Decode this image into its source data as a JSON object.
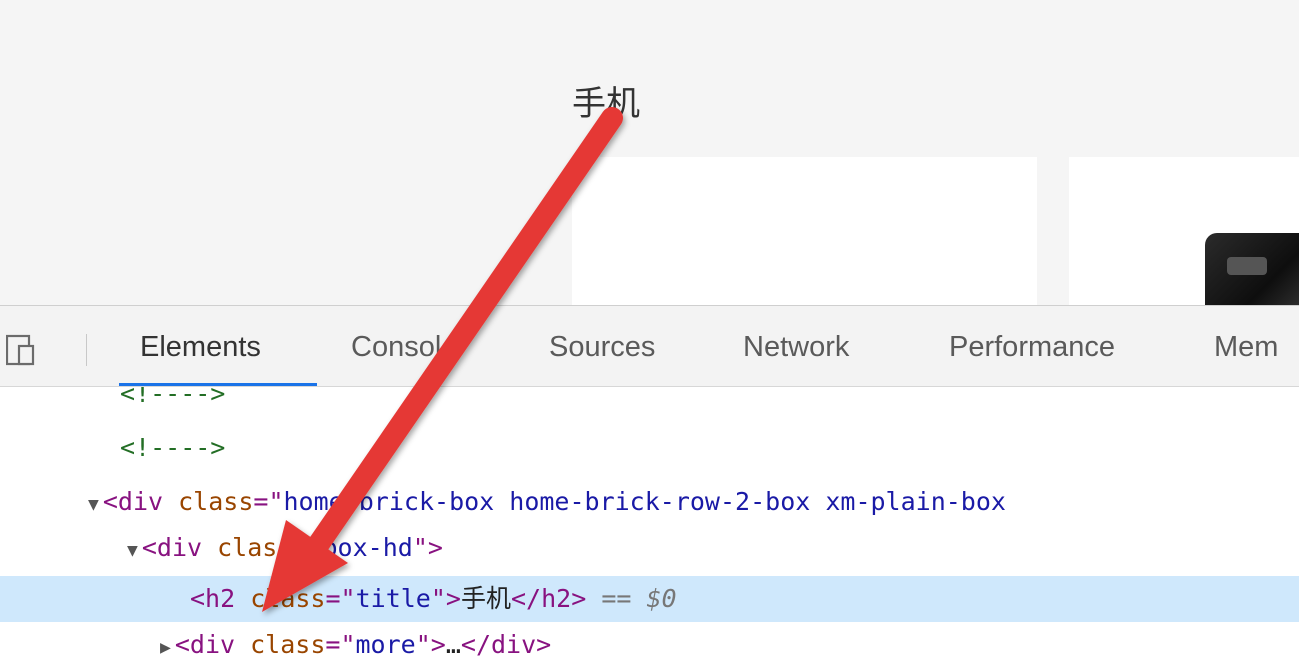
{
  "page": {
    "heading": "手机"
  },
  "devtools": {
    "tabs": [
      {
        "label": "Elements"
      },
      {
        "label": "Console"
      },
      {
        "label": "Sources"
      },
      {
        "label": "Network"
      },
      {
        "label": "Performance"
      },
      {
        "label": "Mem"
      }
    ],
    "active_tab": "Elements",
    "dom": {
      "comment1": "<!---->",
      "comment2": "<!---->",
      "div_outer": {
        "tag_open": "<div",
        "attr": "class",
        "eq": "=\"",
        "value": "home-brick-box home-brick-row-2-box xm-plain-box"
      },
      "div_hd": {
        "tag_open": "<div",
        "attr": "class",
        "eq": "=\"",
        "value": "box-hd",
        "close": "\">"
      },
      "h2": {
        "tag_open": "<h2",
        "attr": "class",
        "eq": "=\"",
        "value": "title",
        "close": "\">",
        "text": "手机",
        "tag_close": "</h2>",
        "ref": "== $0"
      },
      "div_more": {
        "tag_open": "<div",
        "attr": "class",
        "eq": "=\"",
        "value": "more",
        "close": "\">",
        "ellipsis": "…",
        "tag_close": "</div>"
      }
    }
  },
  "colors": {
    "accent": "#1a73e8",
    "selected_row": "#cfe8fc",
    "arrow": "#e53935"
  }
}
